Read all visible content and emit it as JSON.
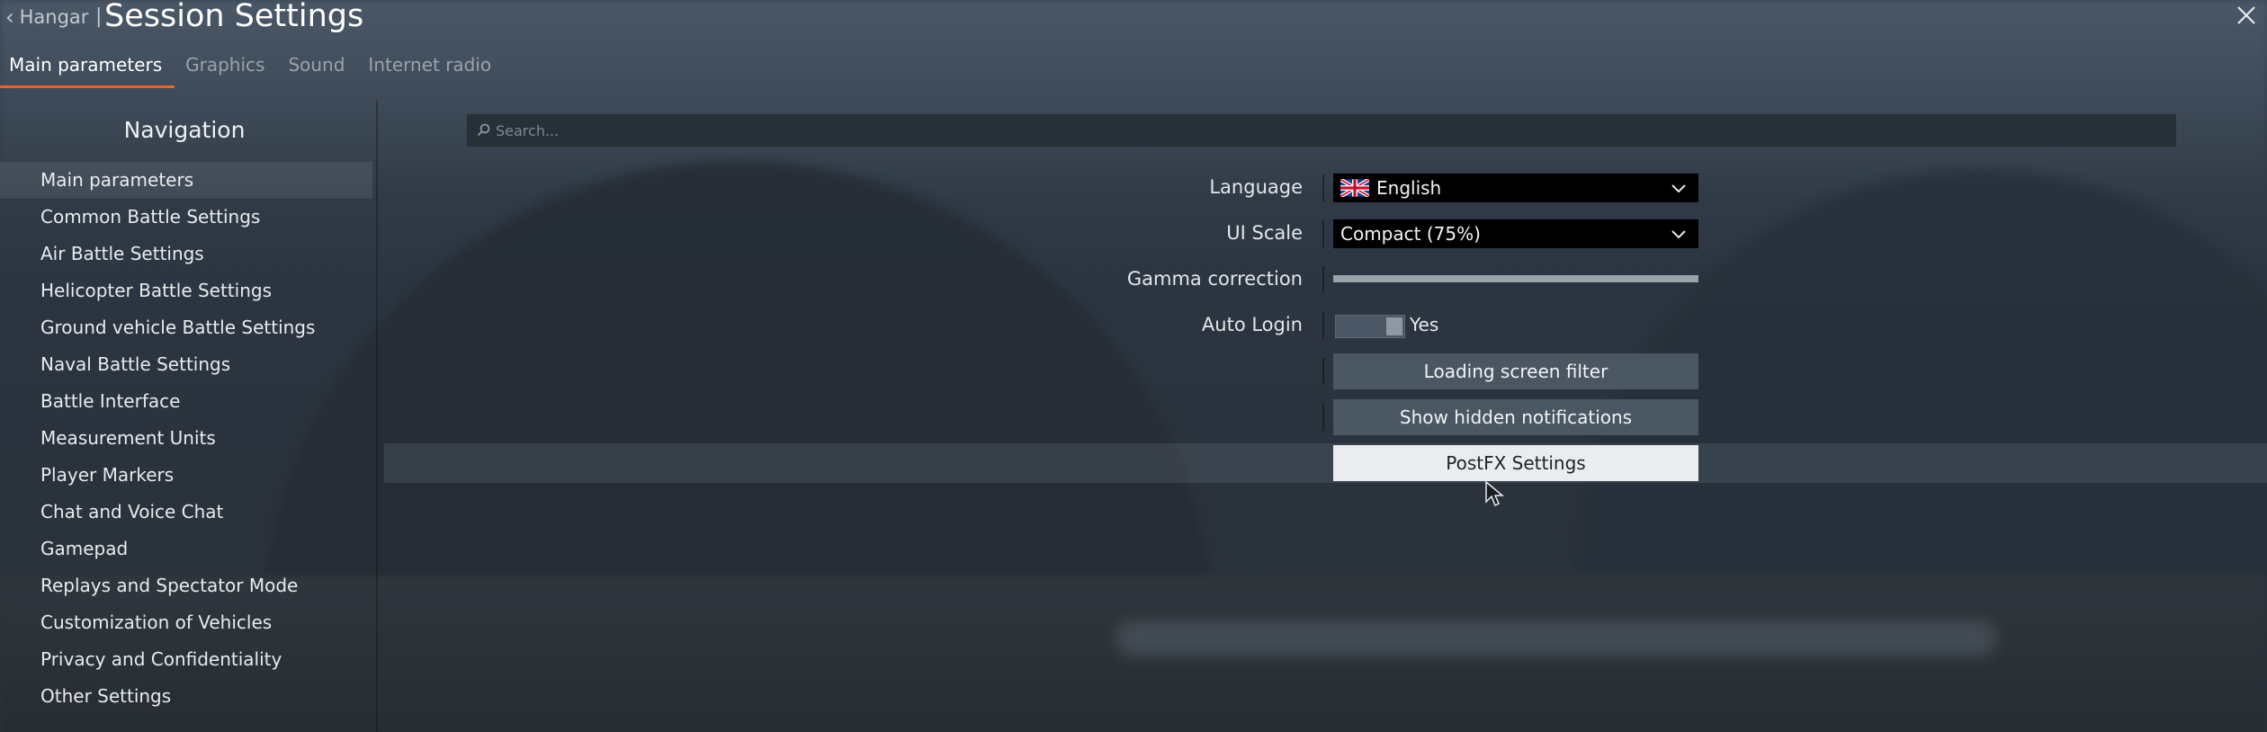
{
  "header": {
    "back_label": "Hangar",
    "separator": "|",
    "title": "Session Settings"
  },
  "tabs": [
    {
      "label": "Main parameters",
      "active": true
    },
    {
      "label": "Graphics",
      "active": false
    },
    {
      "label": "Sound",
      "active": false
    },
    {
      "label": "Internet radio",
      "active": false
    }
  ],
  "navigation": {
    "title": "Navigation",
    "items": [
      {
        "label": "Main parameters",
        "selected": true
      },
      {
        "label": "Common Battle Settings"
      },
      {
        "label": "Air Battle Settings"
      },
      {
        "label": "Helicopter Battle Settings"
      },
      {
        "label": "Ground vehicle Battle Settings"
      },
      {
        "label": "Naval Battle Settings"
      },
      {
        "label": "Battle Interface"
      },
      {
        "label": "Measurement Units"
      },
      {
        "label": "Player Markers"
      },
      {
        "label": "Chat and Voice Chat"
      },
      {
        "label": "Gamepad"
      },
      {
        "label": "Replays and Spectator Mode"
      },
      {
        "label": "Customization of Vehicles"
      },
      {
        "label": "Privacy and Confidentiality"
      },
      {
        "label": "Other Settings"
      }
    ]
  },
  "search": {
    "placeholder": "Search...",
    "value": ""
  },
  "settings": {
    "language": {
      "label": "Language",
      "value": "English",
      "flag_icon": "uk-flag-icon"
    },
    "ui_scale": {
      "label": "UI Scale",
      "value": "Compact (75%)"
    },
    "gamma": {
      "label": "Gamma correction",
      "level": 1.0
    },
    "auto_login": {
      "label": "Auto Login",
      "value": "Yes",
      "on": true
    }
  },
  "buttons": {
    "loading_screen_filter": "Loading screen filter",
    "show_hidden_notifications": "Show hidden notifications",
    "postfx_settings": "PostFX Settings"
  },
  "colors": {
    "accent": "#e8622f",
    "button_bg": "#4a5763",
    "button_hover_bg": "#ebecee",
    "dropdown_bg": "#000000"
  }
}
